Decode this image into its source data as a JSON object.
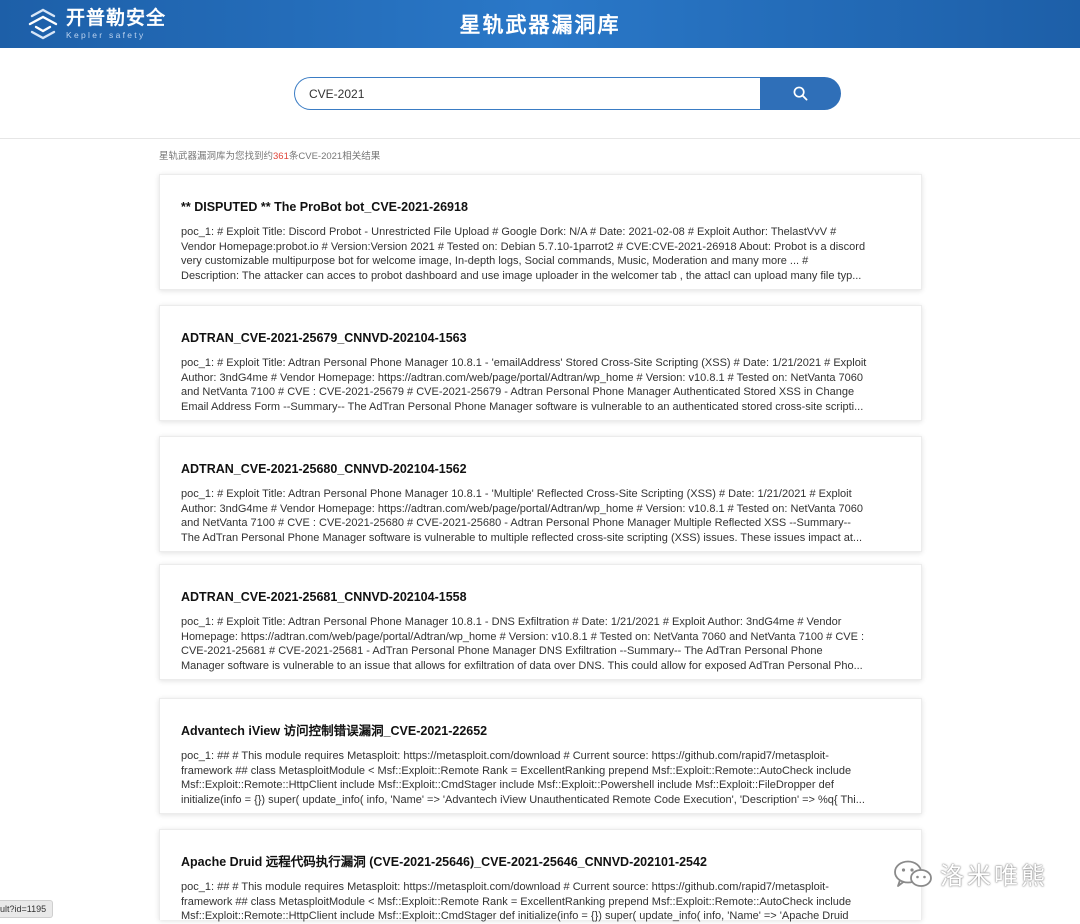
{
  "header": {
    "logo_cn": "开普勒安全",
    "logo_en": "Kepler safety",
    "title": "星轨武器漏洞库"
  },
  "search": {
    "value": "CVE-2021",
    "button_icon": "search-icon"
  },
  "result_summary": {
    "prefix": "星轨武器漏洞库为您找到约",
    "count": "361",
    "suffix": "条CVE-2021相关结果"
  },
  "results": [
    {
      "title": "** DISPUTED ** The ProBot bot_CVE-2021-26918",
      "lines": [
        "poc_1: # Exploit Title: Discord Probot - Unrestricted File Upload # Google Dork: N/A # Date: 2021-02-08 # Exploit Author: ThelastVvV #",
        "Vendor Homepage:probot.io # Version:Version 2021 # Tested on: Debian 5.7.10-1parrot2 # CVE:CVE-2021-26918 About: Probot is a discord",
        "very customizable multipurpose bot for welcome image, In-depth logs, Social commands, Music, Moderation and many more ... #",
        "Description: The attacker can acces to probot dashboard and use image uploader in the welcomer tab , the attacl can upload many file typ..."
      ]
    },
    {
      "title": "ADTRAN_CVE-2021-25679_CNNVD-202104-1563",
      "lines": [
        "poc_1: # Exploit Title: Adtran Personal Phone Manager 10.8.1 - 'emailAddress' Stored Cross-Site Scripting (XSS) # Date: 1/21/2021 # Exploit",
        "Author: 3ndG4me # Vendor Homepage: https://adtran.com/web/page/portal/Adtran/wp_home # Version: v10.8.1 # Tested on: NetVanta 7060",
        "and NetVanta 7100 # CVE : CVE-2021-25679 # CVE-2021-25679 - Adtran Personal Phone Manager Authenticated Stored XSS in Change",
        "Email Address Form --Summary-- The AdTran Personal Phone Manager software is vulnerable to an authenticated stored cross-site scripti..."
      ]
    },
    {
      "title": "ADTRAN_CVE-2021-25680_CNNVD-202104-1562",
      "lines": [
        "poc_1: # Exploit Title: Adtran Personal Phone Manager 10.8.1 - 'Multiple' Reflected Cross-Site Scripting (XSS) # Date: 1/21/2021 # Exploit",
        "Author: 3ndG4me # Vendor Homepage: https://adtran.com/web/page/portal/Adtran/wp_home # Version: v10.8.1 # Tested on: NetVanta 7060",
        "and NetVanta 7100 # CVE : CVE-2021-25680 # CVE-2021-25680 - Adtran Personal Phone Manager Multiple Reflected XSS --Summary--",
        "The AdTran Personal Phone Manager software is vulnerable to multiple reflected cross-site scripting (XSS) issues. These issues impact at..."
      ]
    },
    {
      "title": "ADTRAN_CVE-2021-25681_CNNVD-202104-1558",
      "lines": [
        "poc_1: # Exploit Title: Adtran Personal Phone Manager 10.8.1 - DNS Exfiltration # Date: 1/21/2021 # Exploit Author: 3ndG4me # Vendor",
        "Homepage: https://adtran.com/web/page/portal/Adtran/wp_home # Version: v10.8.1 # Tested on: NetVanta 7060 and NetVanta 7100 # CVE :",
        "CVE-2021-25681 # CVE-2021-25681 - AdTran Personal Phone Manager DNS Exfiltration --Summary-- The AdTran Personal Phone",
        "Manager software is vulnerable to an issue that allows for exfiltration of data over DNS. This could allow for exposed AdTran Personal Pho..."
      ]
    },
    {
      "title": "Advantech iView 访问控制错误漏洞_CVE-2021-22652",
      "lines": [
        "poc_1: ## # This module requires Metasploit: https://metasploit.com/download # Current source: https://github.com/rapid7/metasploit-",
        "framework ## class MetasploitModule < Msf::Exploit::Remote Rank = ExcellentRanking prepend Msf::Exploit::Remote::AutoCheck include",
        "Msf::Exploit::Remote::HttpClient include Msf::Exploit::CmdStager include Msf::Exploit::Powershell include Msf::Exploit::FileDropper def",
        "initialize(info = {}) super( update_info( info, 'Name' => 'Advantech iView Unauthenticated Remote Code Execution', 'Description' => %q{ Thi..."
      ]
    },
    {
      "title": "Apache Druid 远程代码执行漏洞 (CVE-2021-25646)_CVE-2021-25646_CNNVD-202101-2542",
      "lines": [
        "poc_1: ## # This module requires Metasploit: https://metasploit.com/download # Current source: https://github.com/rapid7/metasploit-",
        "framework ## class MetasploitModule < Msf::Exploit::Remote Rank = ExcellentRanking prepend Msf::Exploit::Remote::AutoCheck include",
        "Msf::Exploit::Remote::HttpClient include Msf::Exploit::CmdStager def initialize(info = {}) super( update_info( info, 'Name' => 'Apache Druid"
      ]
    }
  ],
  "status_url": "ult?id=1195",
  "watermark": {
    "text": "洛米唯熊",
    "icon": "wechat-icon"
  }
}
